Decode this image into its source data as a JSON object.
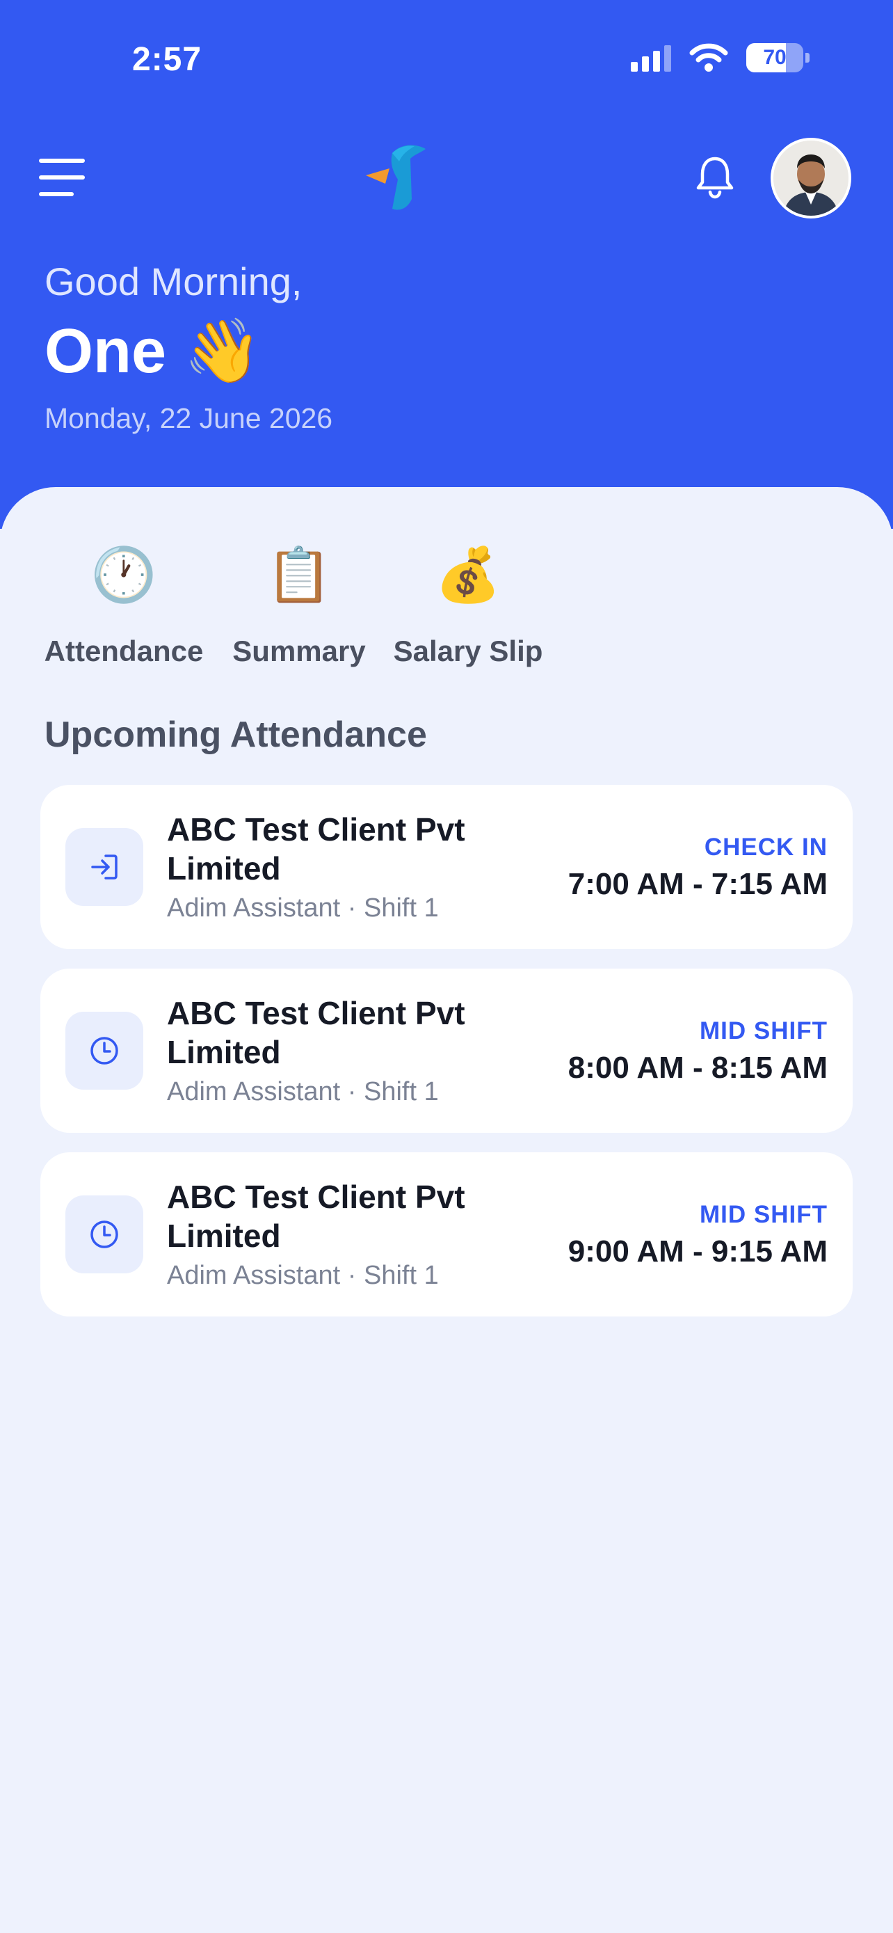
{
  "status_bar": {
    "time": "2:57",
    "battery": "70",
    "battery_level_pct": 70
  },
  "header": {
    "icons": {
      "menu": "hamburger-menu-icon",
      "notifications": "bell-icon"
    },
    "greeting": "Good Morning,",
    "name": "One 👋",
    "date": "Monday, 22 June 2026"
  },
  "quick_actions": [
    {
      "label": "Attendance",
      "emoji": "🕐"
    },
    {
      "label": "Summary",
      "emoji": "📋"
    },
    {
      "label": "Salary Slip",
      "emoji": "💰"
    }
  ],
  "upcoming": {
    "title": "Upcoming Attendance",
    "items": [
      {
        "client": "ABC Test Client Pvt Limited",
        "subtitle": "Adim Assistant · Shift 1",
        "kind": "CHECK IN",
        "time": "7:00 AM - 7:15 AM",
        "icon": "check-in-icon"
      },
      {
        "client": "ABC Test Client Pvt Limited",
        "subtitle": "Adim Assistant · Shift 1",
        "kind": "MID SHIFT",
        "time": "8:00 AM - 8:15 AM",
        "icon": "clock-icon"
      },
      {
        "client": "ABC Test Client Pvt Limited",
        "subtitle": "Adim Assistant · Shift 1",
        "kind": "MID SHIFT",
        "time": "9:00 AM - 9:15 AM",
        "icon": "clock-icon"
      }
    ]
  },
  "colors": {
    "primary": "#3359f2",
    "background": "#eef2fd",
    "card": "#ffffff",
    "text_dark": "#161a26",
    "text_muted": "#7b8294"
  }
}
